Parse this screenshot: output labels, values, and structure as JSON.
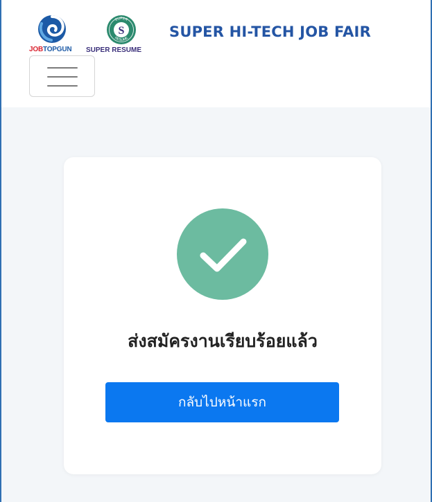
{
  "header": {
    "logo_jobtopgun": {
      "part1": "JOB",
      "part2": "TOPGUN"
    },
    "logo_super_resume": {
      "label": "SUPER RESUME",
      "badge_letter": "S",
      "badge_arc_top": "SUPER",
      "badge_arc_bottom": "RESUME"
    },
    "title": "SUPER HI-TECH JOB FAIR",
    "menu_icon": "hamburger-icon"
  },
  "main": {
    "success_icon": "check-circle-icon",
    "message": "ส่งสมัครงานเรียบร้อยแล้ว",
    "home_button_label": "กลับไปหน้าแรก"
  },
  "colors": {
    "title_blue": "#2455a4",
    "success_green": "#6cbba0",
    "button_blue": "#0b78f0",
    "page_background": "#f3f6f9",
    "frame_border": "#2f6fb3",
    "jobtopgun_red": "#d9232f",
    "jobtopgun_blue": "#1c5aa6",
    "super_resume_purple": "#3a2f7a"
  }
}
